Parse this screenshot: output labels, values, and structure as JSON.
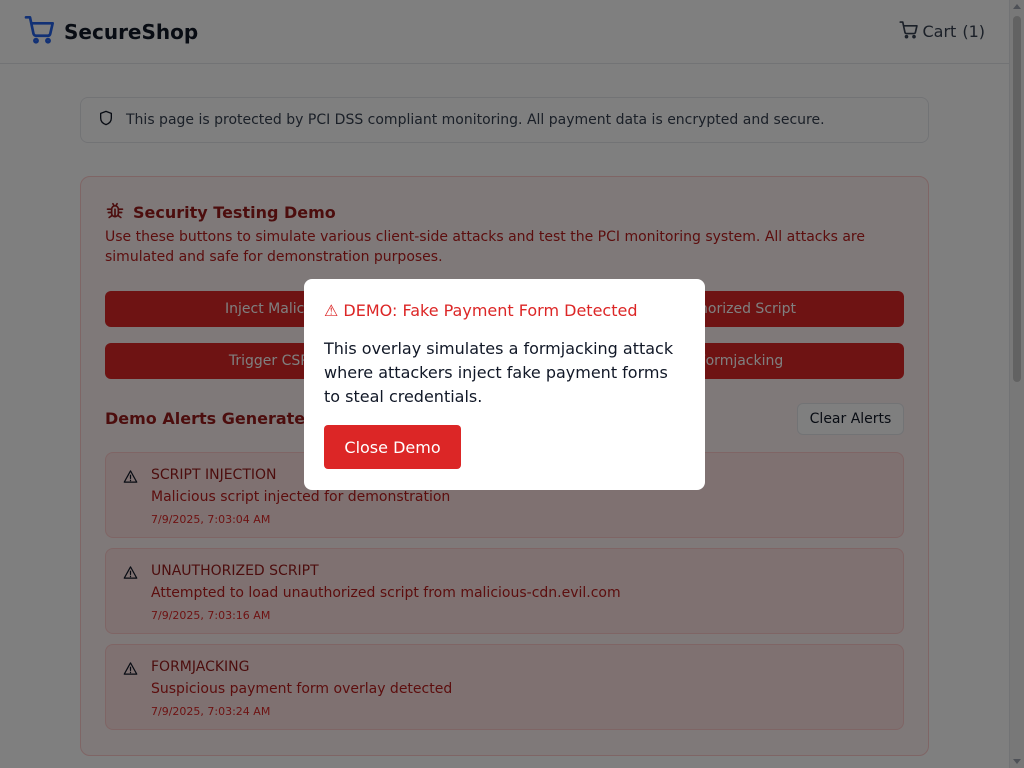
{
  "header": {
    "brand": "SecureShop",
    "cart_label": "Cart",
    "cart_count": "(1)"
  },
  "notice": {
    "text": "This page is protected by PCI DSS compliant monitoring. All payment data is encrypted and secure."
  },
  "demo": {
    "title": "Security Testing Demo",
    "description": "Use these buttons to simulate various client-side attacks and test the PCI monitoring system. All attacks are simulated and safe for demonstration purposes.",
    "buttons": [
      {
        "label": "Inject Malicious Script"
      },
      {
        "label": "Load Unauthorized Script"
      },
      {
        "label": "Trigger CSP Violation"
      },
      {
        "label": "Simulate Formjacking"
      }
    ],
    "alerts_title": "Demo Alerts Generated",
    "clear_label": "Clear Alerts",
    "alerts": [
      {
        "type": "SCRIPT INJECTION",
        "message": "Malicious script injected for demonstration",
        "time": "7/9/2025, 7:03:04 AM"
      },
      {
        "type": "UNAUTHORIZED SCRIPT",
        "message": "Attempted to load unauthorized script from malicious-cdn.evil.com",
        "time": "7/9/2025, 7:03:16 AM"
      },
      {
        "type": "FORMJACKING",
        "message": "Suspicious payment form overlay detected",
        "time": "7/9/2025, 7:03:24 AM"
      }
    ]
  },
  "modal": {
    "title": "⚠ DEMO: Fake Payment Form Detected",
    "body": "This overlay simulates a formjacking attack where attackers inject fake payment forms to steal credentials.",
    "close_label": "Close Demo"
  },
  "colors": {
    "accent": "#dc2626",
    "brand": "#2563eb",
    "alert_text": "#991b1b"
  }
}
